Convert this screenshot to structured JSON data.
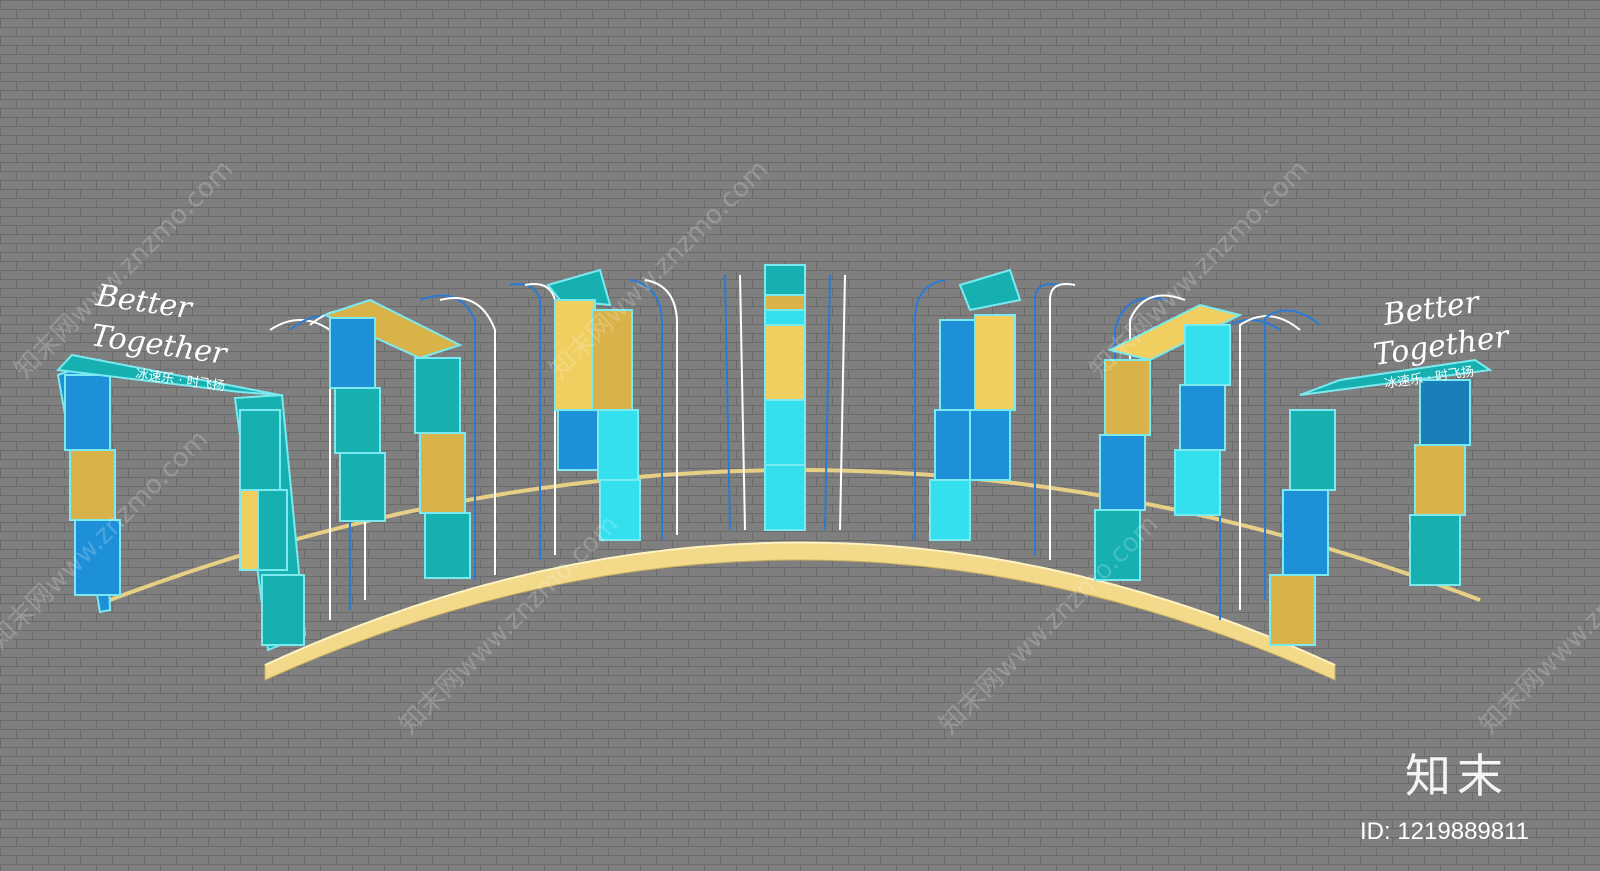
{
  "signs": {
    "left": {
      "line1": "Better",
      "line2": "Together",
      "banner": "冰速乐 · 时飞扬"
    },
    "right": {
      "line1": "Better",
      "line2": "Together",
      "banner": "冰速乐 · 时飞扬"
    }
  },
  "watermark": {
    "text": "知末网www.znzmo.com"
  },
  "brand": {
    "logo": "知末",
    "id": "ID: 1219889811"
  },
  "colors": {
    "background": "#7f7f7f",
    "tile_grout": "#6b6b6b",
    "base": "#f3d98a",
    "blue": "#1e90d8",
    "teal": "#16b0b0",
    "cyan": "#34dfee",
    "gold": "#d9b34a",
    "frame": "#7aeaf0"
  }
}
